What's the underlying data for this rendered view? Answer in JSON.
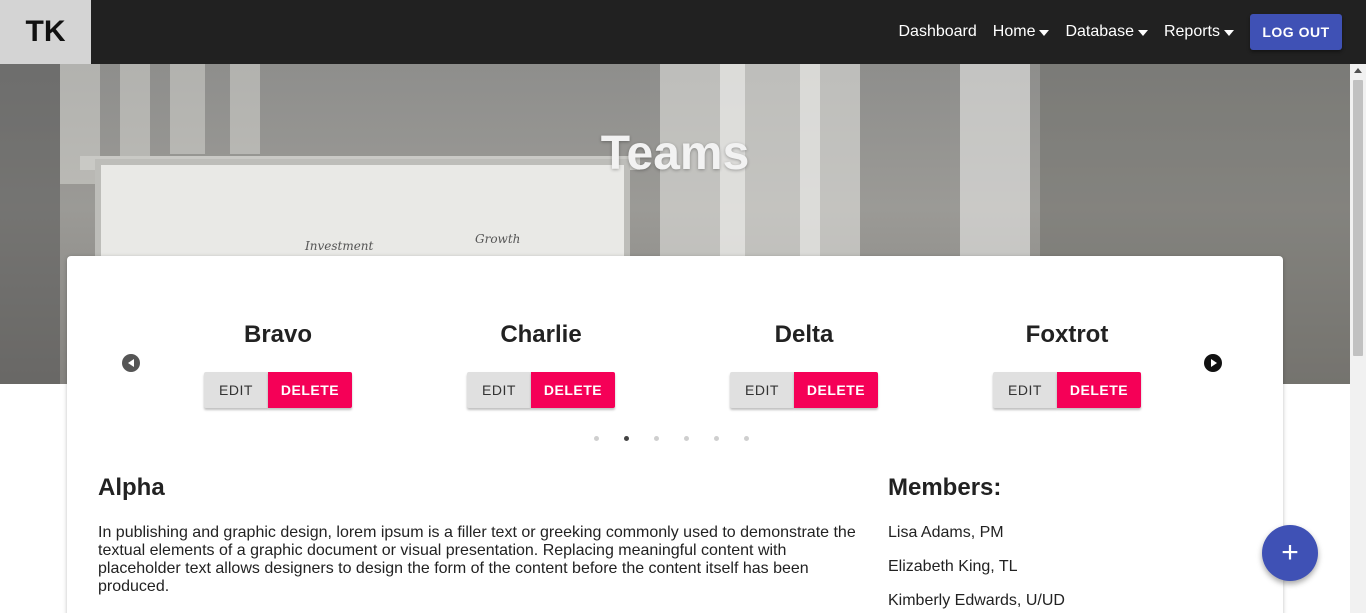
{
  "brand": {
    "label": "TK"
  },
  "nav": {
    "links": [
      {
        "label": "Dashboard",
        "has_caret": false
      },
      {
        "label": "Home",
        "has_caret": true
      },
      {
        "label": "Database",
        "has_caret": true
      },
      {
        "label": "Reports",
        "has_caret": true
      }
    ],
    "logout_label": "LOG OUT"
  },
  "hero": {
    "title": "Teams",
    "scribbles": [
      "Investment",
      "Growth"
    ]
  },
  "carousel": {
    "teams": [
      {
        "name": "Bravo",
        "edit_label": "EDIT",
        "delete_label": "DELETE"
      },
      {
        "name": "Charlie",
        "edit_label": "EDIT",
        "delete_label": "DELETE"
      },
      {
        "name": "Delta",
        "edit_label": "EDIT",
        "delete_label": "DELETE"
      },
      {
        "name": "Foxtrot",
        "edit_label": "EDIT",
        "delete_label": "DELETE"
      }
    ],
    "dot_count": 6,
    "active_dot": 2
  },
  "detail": {
    "title": "Alpha",
    "description": "In publishing and graphic design, lorem ipsum is a filler text or greeking commonly used to demonstrate the textual elements of a graphic document or visual presentation. Replacing meaningful content with placeholder text allows designers to design the form of the content before the content itself has been produced.",
    "members_title": "Members:",
    "members": [
      "Lisa Adams, PM",
      "Elizabeth King, TL",
      "Kimberly Edwards, U/UD"
    ]
  },
  "fab": {
    "icon": "plus-icon",
    "label": "+"
  },
  "colors": {
    "navbar": "#212121",
    "primary": "#3f51b5",
    "danger": "#f50057"
  }
}
